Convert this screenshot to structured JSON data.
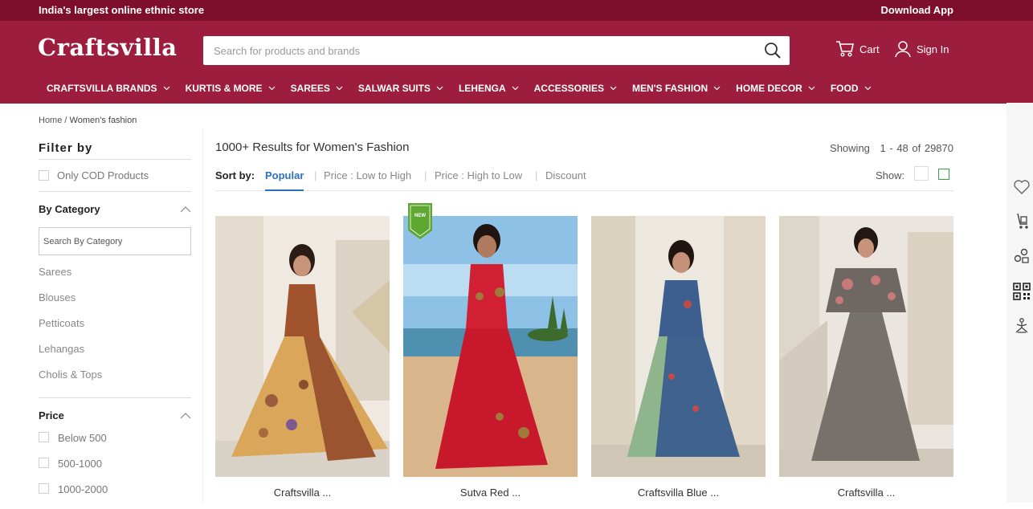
{
  "topbar": {
    "tagline": "India's largest online ethnic store",
    "download": "Download App"
  },
  "header": {
    "logo": "Craftsvilla",
    "search_placeholder": "Search for products and brands",
    "cart": "Cart",
    "signin": "Sign In"
  },
  "nav": [
    "CRAFTSVILLA BRANDS",
    "KURTIS & MORE",
    "SAREES",
    "SALWAR SUITS",
    "LEHENGA",
    "ACCESSORIES",
    "MEN'S FASHION",
    "HOME DECOR",
    "FOOD"
  ],
  "breadcrumb": {
    "home": "Home",
    "sep": "/",
    "current": "Women's fashion"
  },
  "sidebar": {
    "title": "Filter by",
    "cod": "Only COD Products",
    "category_title": "By Category",
    "category_placeholder": "Search By Category",
    "categories": [
      "Sarees",
      "Blouses",
      "Petticoats",
      "Lehangas",
      "Cholis & Tops"
    ],
    "price_title": "Price",
    "prices": [
      "Below 500",
      "500-1000",
      "1000-2000"
    ]
  },
  "results": {
    "count": "1000+ Results for",
    "query": "Women's Fashion",
    "showing_label": "Showing",
    "showing_range": "1 - 48 of 29870"
  },
  "sort": {
    "label": "Sort by:",
    "options": [
      "Popular",
      "Price : Low to High",
      "Price : High to Low",
      "Discount"
    ],
    "show_label": "Show:"
  },
  "products": [
    {
      "name": "Craftsvilla ...",
      "new": false
    },
    {
      "name": "Sutva Red ...",
      "new": true
    },
    {
      "name": "Craftsvilla Blue ...",
      "new": false
    },
    {
      "name": "Craftsvilla ...",
      "new": false
    }
  ],
  "badge": {
    "new": "NEW"
  },
  "colors": {
    "brand": "#9c1d3d",
    "topbar": "#7d0f2c",
    "active_sort": "#2f6fbe",
    "new_badge": "#5fa733"
  },
  "rail_icons": [
    "heart-icon",
    "cart-trolley-icon",
    "account-share-icon",
    "qr-code-icon",
    "yoga-icon"
  ]
}
